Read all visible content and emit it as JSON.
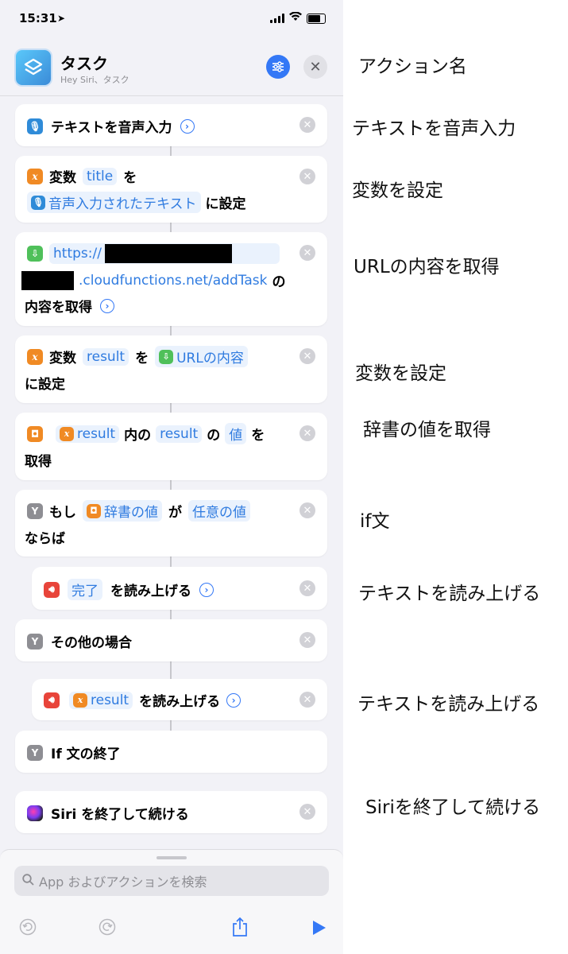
{
  "status_bar": {
    "time": "15:31"
  },
  "header": {
    "title": "タスク",
    "subtitle": "Hey Siri、タスク"
  },
  "actions": {
    "dictate": {
      "label": "テキストを音声入力"
    },
    "setvar1": {
      "w1": "変数",
      "var": "title",
      "w2": "を",
      "input": "音声入力されたテキスト",
      "w3": "に設定"
    },
    "geturl": {
      "scheme": "https://",
      "domain": ".cloudfunctions.net/addTask",
      "w1": "の",
      "w2": "内容を取得"
    },
    "setvar2": {
      "w1": "変数",
      "var": "result",
      "w2": "を",
      "input": "URLの内容",
      "w3": "に設定"
    },
    "dictval": {
      "var": "result",
      "w1": "内の",
      "dict": "result",
      "w2": "の",
      "key": "値",
      "w3": "を",
      "w4": "取得"
    },
    "ifblock": {
      "w1": "もし",
      "input": "辞書の値",
      "w2": "が",
      "cond": "任意の値",
      "w3": "ならば"
    },
    "speak1": {
      "text": "完了",
      "w1": "を読み上げる"
    },
    "otherwise": {
      "label": "その他の場合"
    },
    "speak2": {
      "var": "result",
      "w1": "を読み上げる"
    },
    "endif": {
      "label": "If 文の終了"
    },
    "siri": {
      "label": "Siri を終了して続ける"
    }
  },
  "search": {
    "placeholder": "App およびアクションを検索"
  },
  "annotations": {
    "a1": "アクション名",
    "a2": "テキストを音声入力",
    "a3": "変数を設定",
    "a4": "URLの内容を取得",
    "a5": "変数を設定",
    "a6": "辞書の値を取得",
    "a7": "if文",
    "a8": "テキストを読み上げる",
    "a9": "テキストを読み上げる",
    "a10": "Siriを終了して続ける"
  }
}
